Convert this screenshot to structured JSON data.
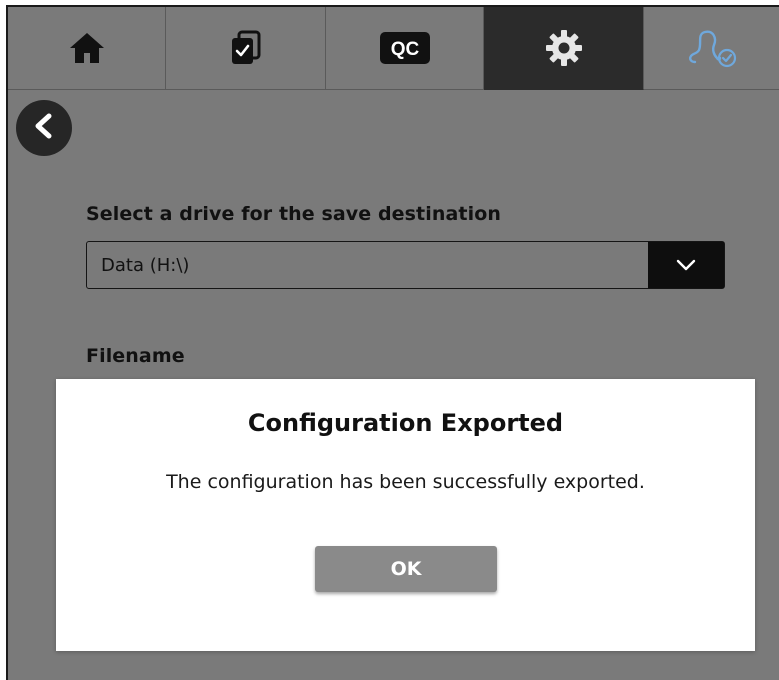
{
  "nav": {
    "tabs": [
      {
        "icon": "home-icon",
        "active": false
      },
      {
        "icon": "checklist-copy-icon",
        "active": false
      },
      {
        "icon": "qc-icon",
        "label": "QC",
        "active": false
      },
      {
        "icon": "gear-icon",
        "active": true
      },
      {
        "icon": "user-verified-icon",
        "active": false
      }
    ]
  },
  "back": {
    "icon": "chevron-left-icon"
  },
  "form": {
    "drive_label": "Select a drive for the save destination",
    "drive_value": "Data (H:\\)",
    "drive_dropdown_icon": "chevron-down-icon",
    "filename_label": "Filename"
  },
  "dialog": {
    "title": "Configuration Exported",
    "message": "The configuration has been successfully exported.",
    "ok_label": "OK"
  },
  "colors": {
    "background": "#7a7a7a",
    "active_tab": "#2b2b2b",
    "accent_user_icon": "#6fa8dc",
    "ok_button": "#8a8a8a"
  }
}
